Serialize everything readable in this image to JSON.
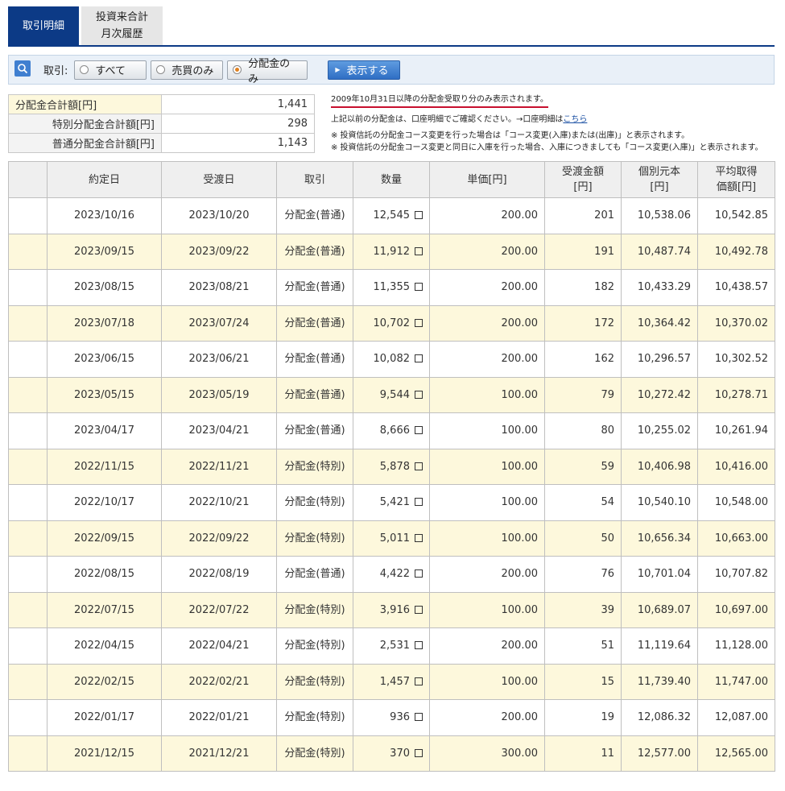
{
  "tabs": [
    {
      "label": "取引明細"
    },
    {
      "label": "投資来合計\n月次履歴"
    }
  ],
  "filter": {
    "label": "取引:",
    "options": [
      "すべて",
      "売買のみ",
      "分配金のみ"
    ],
    "selected": "分配金のみ",
    "submit_label": "表示する"
  },
  "summary": [
    {
      "label": "分配金合計額[円]",
      "value": "1,441"
    },
    {
      "label": "特別分配金合計額[円]",
      "value": "298"
    },
    {
      "label": "普通分配金合計額[円]",
      "value": "1,143"
    }
  ],
  "notes": {
    "line1": "2009年10月31日以降の分配金受取り分のみ表示されます。",
    "line2_prefix": "上記以前の分配金は、口座明細でご確認ください。→口座明細は",
    "line2_link": "こちら",
    "line3": "※ 投資信託の分配金コース変更を行った場合は「コース変更(入庫)または(出庫)」と表示されます。",
    "line4": "※ 投資信託の分配金コース変更と同日に入庫を行った場合、入庫につきましても「コース変更(入庫)」と表示されます。"
  },
  "table": {
    "headers": [
      "",
      "約定日",
      "受渡日",
      "取引",
      "数量",
      "単価[円]",
      "受渡金額\n[円]",
      "個別元本\n[円]",
      "平均取得\n価額[円]"
    ],
    "rows": [
      {
        "trade_date": "2023/10/16",
        "settle_date": "2023/10/20",
        "type": "分配金(普通)",
        "qty": "12,545",
        "price": "200.00",
        "amount": "201",
        "principal": "10,538.06",
        "avg_cost": "10,542.85"
      },
      {
        "trade_date": "2023/09/15",
        "settle_date": "2023/09/22",
        "type": "分配金(普通)",
        "qty": "11,912",
        "price": "200.00",
        "amount": "191",
        "principal": "10,487.74",
        "avg_cost": "10,492.78"
      },
      {
        "trade_date": "2023/08/15",
        "settle_date": "2023/08/21",
        "type": "分配金(普通)",
        "qty": "11,355",
        "price": "200.00",
        "amount": "182",
        "principal": "10,433.29",
        "avg_cost": "10,438.57"
      },
      {
        "trade_date": "2023/07/18",
        "settle_date": "2023/07/24",
        "type": "分配金(普通)",
        "qty": "10,702",
        "price": "200.00",
        "amount": "172",
        "principal": "10,364.42",
        "avg_cost": "10,370.02"
      },
      {
        "trade_date": "2023/06/15",
        "settle_date": "2023/06/21",
        "type": "分配金(普通)",
        "qty": "10,082",
        "price": "200.00",
        "amount": "162",
        "principal": "10,296.57",
        "avg_cost": "10,302.52"
      },
      {
        "trade_date": "2023/05/15",
        "settle_date": "2023/05/19",
        "type": "分配金(普通)",
        "qty": "9,544",
        "price": "100.00",
        "amount": "79",
        "principal": "10,272.42",
        "avg_cost": "10,278.71"
      },
      {
        "trade_date": "2023/04/17",
        "settle_date": "2023/04/21",
        "type": "分配金(普通)",
        "qty": "8,666",
        "price": "100.00",
        "amount": "80",
        "principal": "10,255.02",
        "avg_cost": "10,261.94"
      },
      {
        "trade_date": "2022/11/15",
        "settle_date": "2022/11/21",
        "type": "分配金(特別)",
        "qty": "5,878",
        "price": "100.00",
        "amount": "59",
        "principal": "10,406.98",
        "avg_cost": "10,416.00"
      },
      {
        "trade_date": "2022/10/17",
        "settle_date": "2022/10/21",
        "type": "分配金(特別)",
        "qty": "5,421",
        "price": "100.00",
        "amount": "54",
        "principal": "10,540.10",
        "avg_cost": "10,548.00"
      },
      {
        "trade_date": "2022/09/15",
        "settle_date": "2022/09/22",
        "type": "分配金(特別)",
        "qty": "5,011",
        "price": "100.00",
        "amount": "50",
        "principal": "10,656.34",
        "avg_cost": "10,663.00"
      },
      {
        "trade_date": "2022/08/15",
        "settle_date": "2022/08/19",
        "type": "分配金(普通)",
        "qty": "4,422",
        "price": "200.00",
        "amount": "76",
        "principal": "10,701.04",
        "avg_cost": "10,707.82"
      },
      {
        "trade_date": "2022/07/15",
        "settle_date": "2022/07/22",
        "type": "分配金(特別)",
        "qty": "3,916",
        "price": "100.00",
        "amount": "39",
        "principal": "10,689.07",
        "avg_cost": "10,697.00"
      },
      {
        "trade_date": "2022/04/15",
        "settle_date": "2022/04/21",
        "type": "分配金(特別)",
        "qty": "2,531",
        "price": "200.00",
        "amount": "51",
        "principal": "11,119.64",
        "avg_cost": "11,128.00"
      },
      {
        "trade_date": "2022/02/15",
        "settle_date": "2022/02/21",
        "type": "分配金(特別)",
        "qty": "1,457",
        "price": "100.00",
        "amount": "15",
        "principal": "11,739.40",
        "avg_cost": "11,747.00"
      },
      {
        "trade_date": "2022/01/17",
        "settle_date": "2022/01/21",
        "type": "分配金(特別)",
        "qty": "936",
        "price": "200.00",
        "amount": "19",
        "principal": "12,086.32",
        "avg_cost": "12,087.00"
      },
      {
        "trade_date": "2021/12/15",
        "settle_date": "2021/12/21",
        "type": "分配金(特別)",
        "qty": "370",
        "price": "300.00",
        "amount": "11",
        "principal": "12,577.00",
        "avg_cost": "12,565.00"
      }
    ]
  },
  "colors": {
    "tab_active": "#0c3a86",
    "row_alt": "#fdf8dc",
    "button_blue": "#2f6ec4",
    "note_underline": "#c8102e"
  },
  "icons": [
    "search-icon",
    "checkbox-icon"
  ]
}
